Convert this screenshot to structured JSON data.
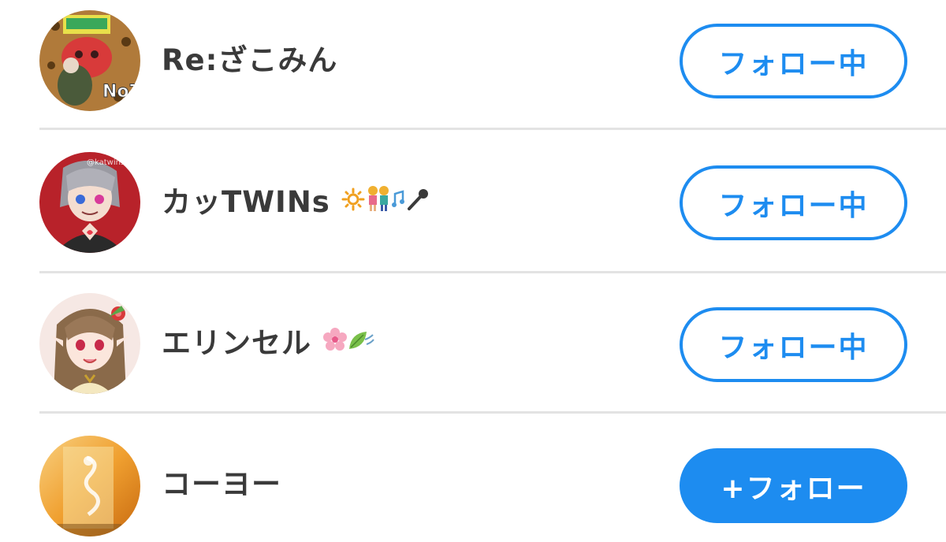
{
  "users": [
    {
      "name": "Re:ざこみん",
      "button_label": "フォロー中",
      "button_state": "following",
      "avatar_icon": "avatar-icon",
      "emojis": []
    },
    {
      "name": "カッTWINs",
      "button_label": "フォロー中",
      "button_state": "following",
      "avatar_icon": "avatar-icon",
      "emojis": [
        "sun-emoji",
        "couple-emoji",
        "music-notes-emoji",
        "microphone-emoji"
      ]
    },
    {
      "name": "エリンセル",
      "button_label": "フォロー中",
      "button_state": "following",
      "avatar_icon": "avatar-icon",
      "emojis": [
        "cherry-blossom-emoji",
        "leaf-wind-emoji"
      ]
    },
    {
      "name": "コーヨー",
      "button_label": "+フォロー",
      "button_state": "not-following",
      "avatar_icon": "avatar-icon",
      "emojis": []
    }
  ],
  "colors": {
    "accent": "#1d8cf0",
    "text": "#3a3a3a",
    "divider": "#e3e3e3",
    "background": "#ffffff"
  }
}
